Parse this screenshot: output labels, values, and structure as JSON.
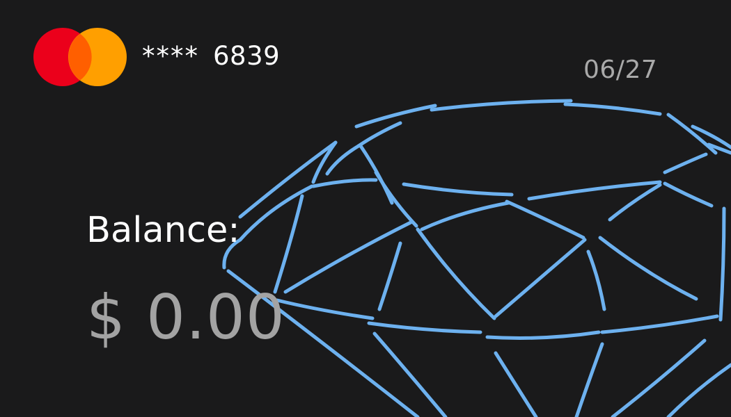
{
  "card": {
    "brand_icon": "mastercard-logo-icon",
    "masked_prefix": "****",
    "last_four": "6839",
    "expiry": "06/27",
    "balance_label": "Balance:",
    "balance_value": "$ 0.00",
    "background_icon": "diamond-outline-icon"
  },
  "colors": {
    "background": "#1a1a1b",
    "diamond_stroke": "#6db1ef",
    "logo_red": "#eb001b",
    "logo_orange": "#ff9f00",
    "logo_overlap": "#ff5f00",
    "text_primary": "#ffffff",
    "text_secondary": "#a9a9a9"
  }
}
